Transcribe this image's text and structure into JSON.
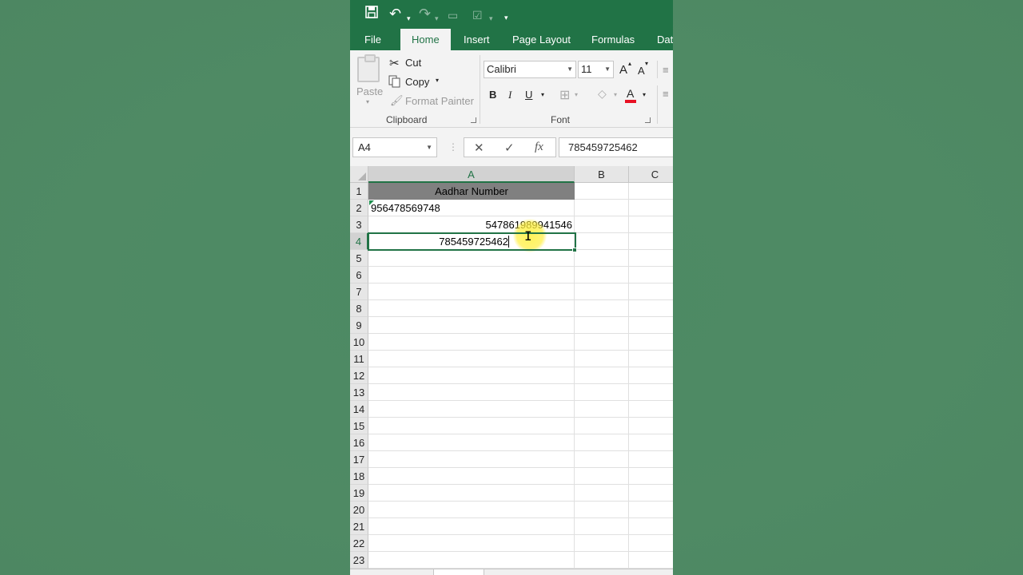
{
  "toolbar": {
    "save_icon": "save-icon",
    "undo_icon": "undo-icon",
    "redo_icon": "redo-icon",
    "customize_icon": "customize-qat-icon"
  },
  "tabs": [
    {
      "label": "File"
    },
    {
      "label": "Home",
      "active": true
    },
    {
      "label": "Insert"
    },
    {
      "label": "Page Layout"
    },
    {
      "label": "Formulas"
    },
    {
      "label": "Dat"
    }
  ],
  "ribbon": {
    "clipboard": {
      "paste_label": "Paste",
      "cut_label": "Cut",
      "copy_label": "Copy",
      "format_painter_label": "Format Painter",
      "group_label": "Clipboard"
    },
    "font": {
      "font_name": "Calibri",
      "font_size": "11",
      "grow_label": "A",
      "shrink_label": "A",
      "bold_label": "B",
      "italic_label": "I",
      "underline_label": "U",
      "font_color_label": "A",
      "font_color": "#e81123",
      "group_label": "Font"
    }
  },
  "formula_bar": {
    "name_box": "A4",
    "cancel_glyph": "✕",
    "enter_glyph": "✓",
    "fx_label": "fx",
    "value": "785459725462"
  },
  "grid": {
    "columns": [
      "A",
      "B",
      "C"
    ],
    "rows": [
      "1",
      "2",
      "3",
      "4",
      "5",
      "6",
      "7",
      "8",
      "9",
      "10",
      "11",
      "12",
      "13",
      "14",
      "15",
      "16",
      "17",
      "18",
      "19",
      "20",
      "21",
      "22",
      "23"
    ],
    "cells": {
      "a1": "Aadhar Number",
      "a2": "956478569748",
      "a3": "547861989941546",
      "a4": "785459725462"
    }
  },
  "colors": {
    "accent": "#217346",
    "header_fill": "#808080",
    "highlight": "#fff03c"
  }
}
